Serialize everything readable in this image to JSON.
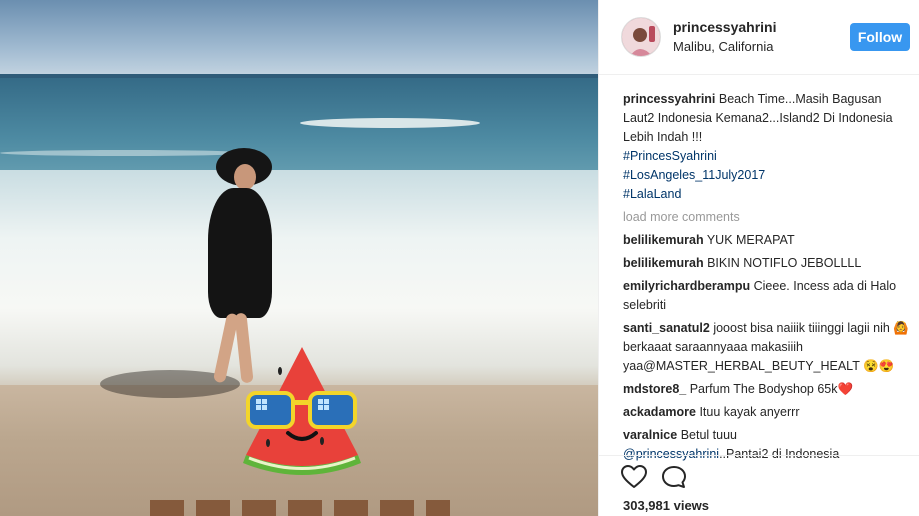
{
  "post": {
    "username": "princessyahrini",
    "location": "Malibu, California",
    "follow_label": "Follow",
    "caption_user": "princessyahrini",
    "caption_text": "Beach Time...Masih Bagusan Laut2 Indonesia Kemana2...Island2 Di Indonesia Lebih Indah !!!",
    "hashtags": [
      "#PrincesSyahrini",
      "#LosAngeles_11July2017",
      "#LalaLand"
    ],
    "load_more": "load more comments",
    "views": "303,981 views"
  },
  "comments": [
    {
      "user": "belilikemurah",
      "text": "YUK MERAPAT"
    },
    {
      "user": "belilikemurah",
      "text": "BIKIN NOTIFLO JEBOLLLL"
    },
    {
      "user": "emilyrichardberampu",
      "text": "Cieee. Incess ada di Halo selebriti"
    },
    {
      "user": "santi_sanatul2",
      "text": "jooost bisa naiiik tiiinggi lagii nih 🙆 berkaaat saraannyaaa makasiiih yaa@MASTER_HERBAL_BEUTY_HEALT 😵😍"
    },
    {
      "user": "mdstore8_",
      "text": "Parfum The Bodyshop 65k❤️"
    },
    {
      "user": "ackadamore",
      "text": "Ituu kayak anyerrr"
    },
    {
      "user": "varalnice",
      "text": "Betul tuuu"
    }
  ],
  "last_comment_mention": "@princessyahrini",
  "last_comment_tail": "..Pantai2 di Indonesia",
  "icons": {
    "like": "heart-icon",
    "comment": "comment-icon"
  },
  "colors": {
    "accent": "#3897f0",
    "link": "#003569",
    "muted": "#999999"
  }
}
